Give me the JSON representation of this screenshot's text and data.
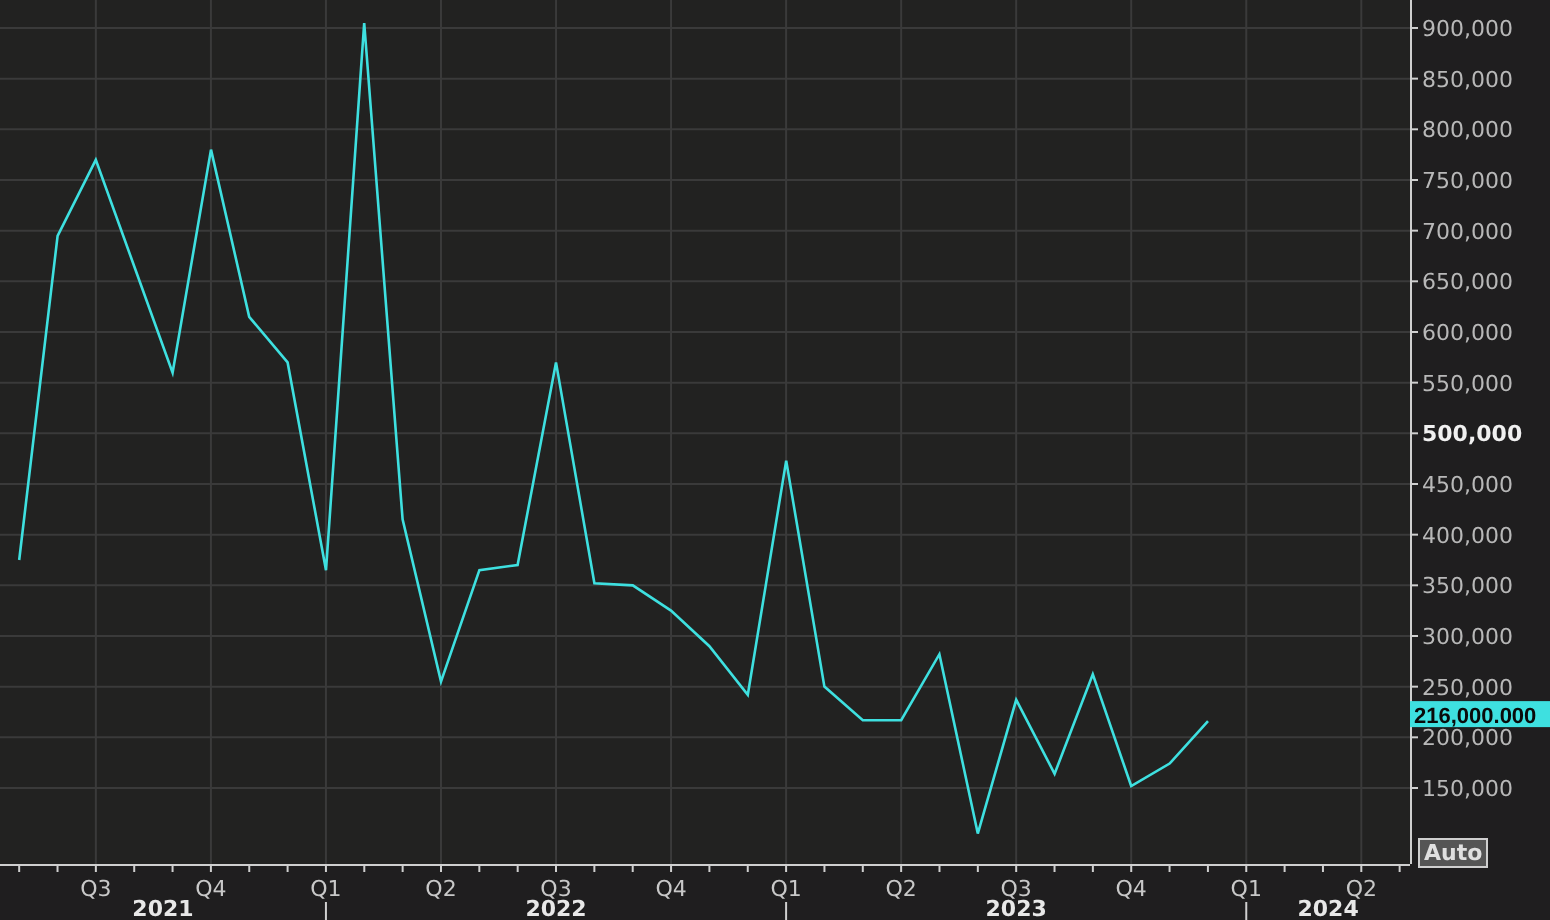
{
  "chart": {
    "chart_data": {
      "type": "line",
      "categories": [
        null,
        null,
        null,
        "Q3",
        null,
        null,
        "Q4",
        null,
        null,
        "Q1",
        null,
        null,
        "Q2",
        null,
        null,
        "Q3",
        null,
        null,
        "Q4",
        null,
        null,
        "Q1",
        null,
        null,
        "Q2",
        null,
        null,
        "Q3",
        null,
        null,
        "Q4",
        null,
        null,
        "Q1",
        null,
        null,
        "Q2",
        null
      ],
      "series": [
        {
          "color": "#3ee0e0",
          "values": [
            null,
            375000,
            695000,
            770000,
            665000,
            560000,
            780000,
            615000,
            570000,
            365000,
            905000,
            415000,
            255000,
            365000,
            370000,
            570000,
            352000,
            350000,
            325000,
            290000,
            242000,
            473000,
            250000,
            217000,
            217000,
            282000,
            105000,
            237000,
            164000,
            262000,
            152000,
            174000,
            216000,
            null,
            null,
            null,
            null,
            null
          ]
        }
      ],
      "grid": true,
      "ylim": [
        75000,
        927600
      ],
      "yticks": [
        {
          "value": 150000,
          "label": "150,000"
        },
        {
          "value": 200000,
          "label": "200,000"
        },
        {
          "value": 250000,
          "label": "250,000"
        },
        {
          "value": 300000,
          "label": "300,000"
        },
        {
          "value": 350000,
          "label": "350,000"
        },
        {
          "value": 400000,
          "label": "400,000"
        },
        {
          "value": 450000,
          "label": "450,000"
        },
        {
          "value": 500000,
          "label": "500,000"
        },
        {
          "value": 550000,
          "label": "550,000"
        },
        {
          "value": 600000,
          "label": "600,000"
        },
        {
          "value": 650000,
          "label": "650,000"
        },
        {
          "value": 700000,
          "label": "700,000"
        },
        {
          "value": 750000,
          "label": "750,000"
        },
        {
          "value": 800000,
          "label": "800,000"
        },
        {
          "value": 850000,
          "label": "850,000"
        },
        {
          "value": 900000,
          "label": "900,000"
        }
      ]
    },
    "ytick_emphasis": [
      false,
      false,
      false,
      false,
      false,
      false,
      false,
      true,
      false,
      false,
      false,
      false,
      false,
      false,
      false,
      false
    ],
    "year_labels": [
      "2021",
      "2022",
      "2023",
      "2024"
    ],
    "last_value_label": "216,000.000"
  },
  "auto_button": "Auto"
}
